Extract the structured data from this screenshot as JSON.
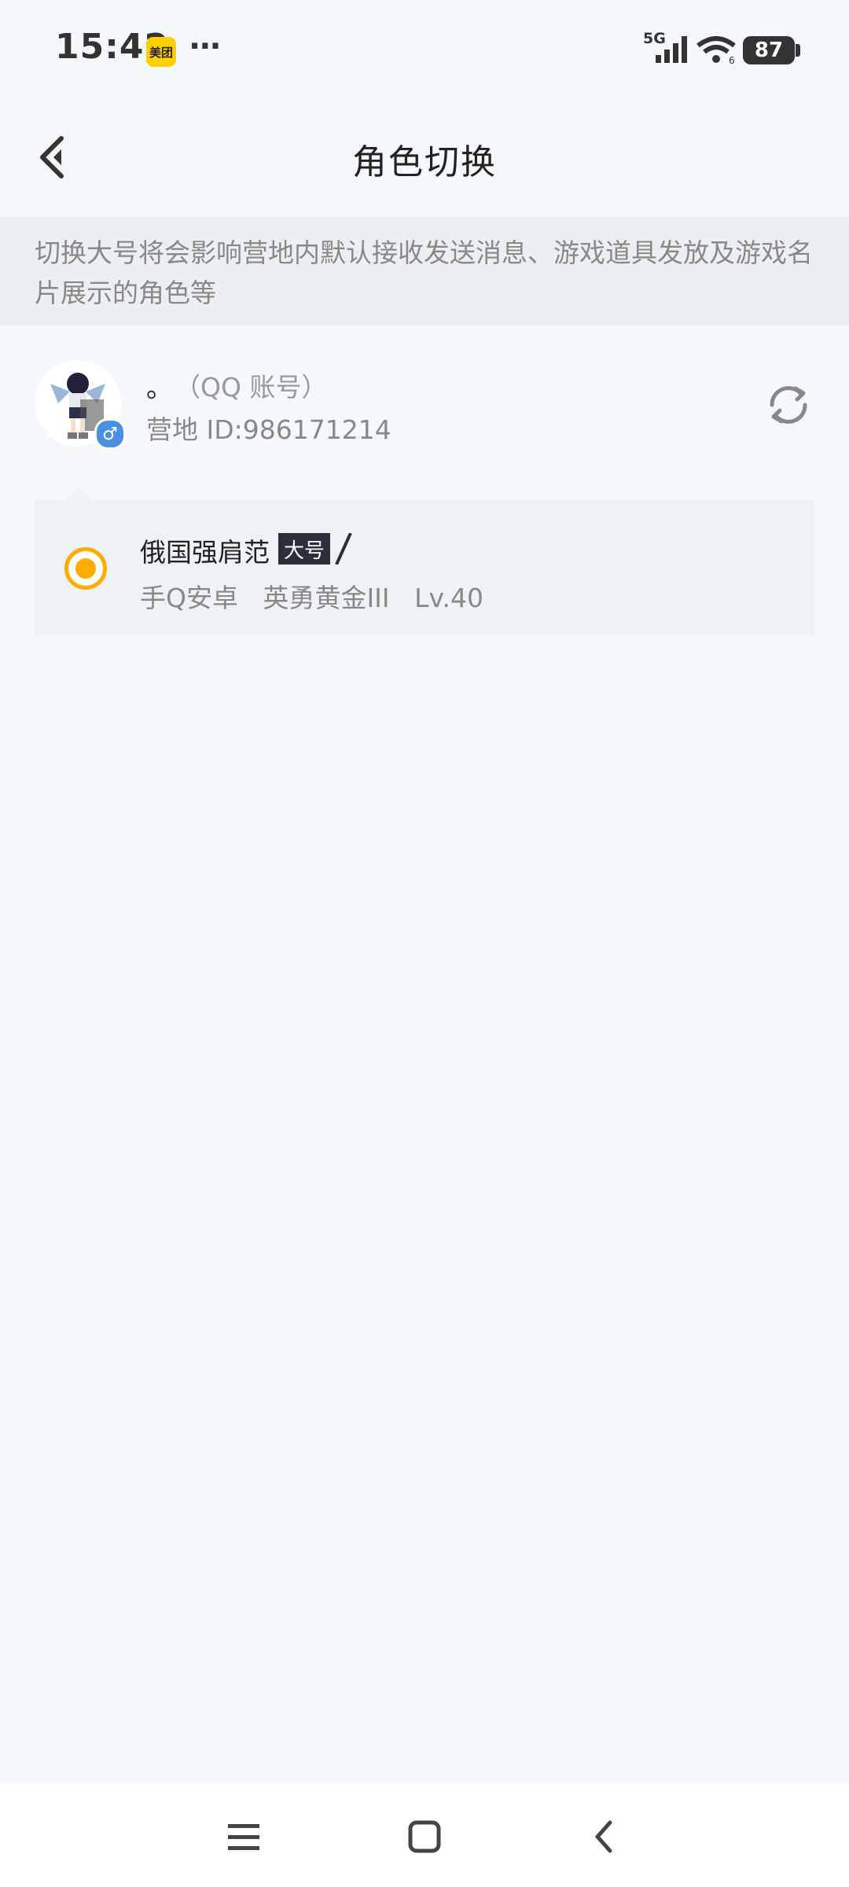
{
  "status_bar": {
    "time": "15:42",
    "app_badge": "美团",
    "more": "···",
    "network": "5G",
    "battery": "87"
  },
  "header": {
    "title": "角色切换"
  },
  "notice": {
    "text": "切换大号将会影响营地内默认接收发送消息、游戏道具发放及游戏名片展示的角色等"
  },
  "account": {
    "name": "。",
    "type": "（QQ 账号）",
    "id": "营地 ID:986171214",
    "gender": "♂"
  },
  "roles": [
    {
      "name": "俄国强肩范",
      "tag": "大号",
      "meta": "手Q安卓   英勇黄金III   Lv.40",
      "selected": true
    }
  ],
  "colors": {
    "accent": "#ffab00",
    "background": "#f5f8fb"
  }
}
